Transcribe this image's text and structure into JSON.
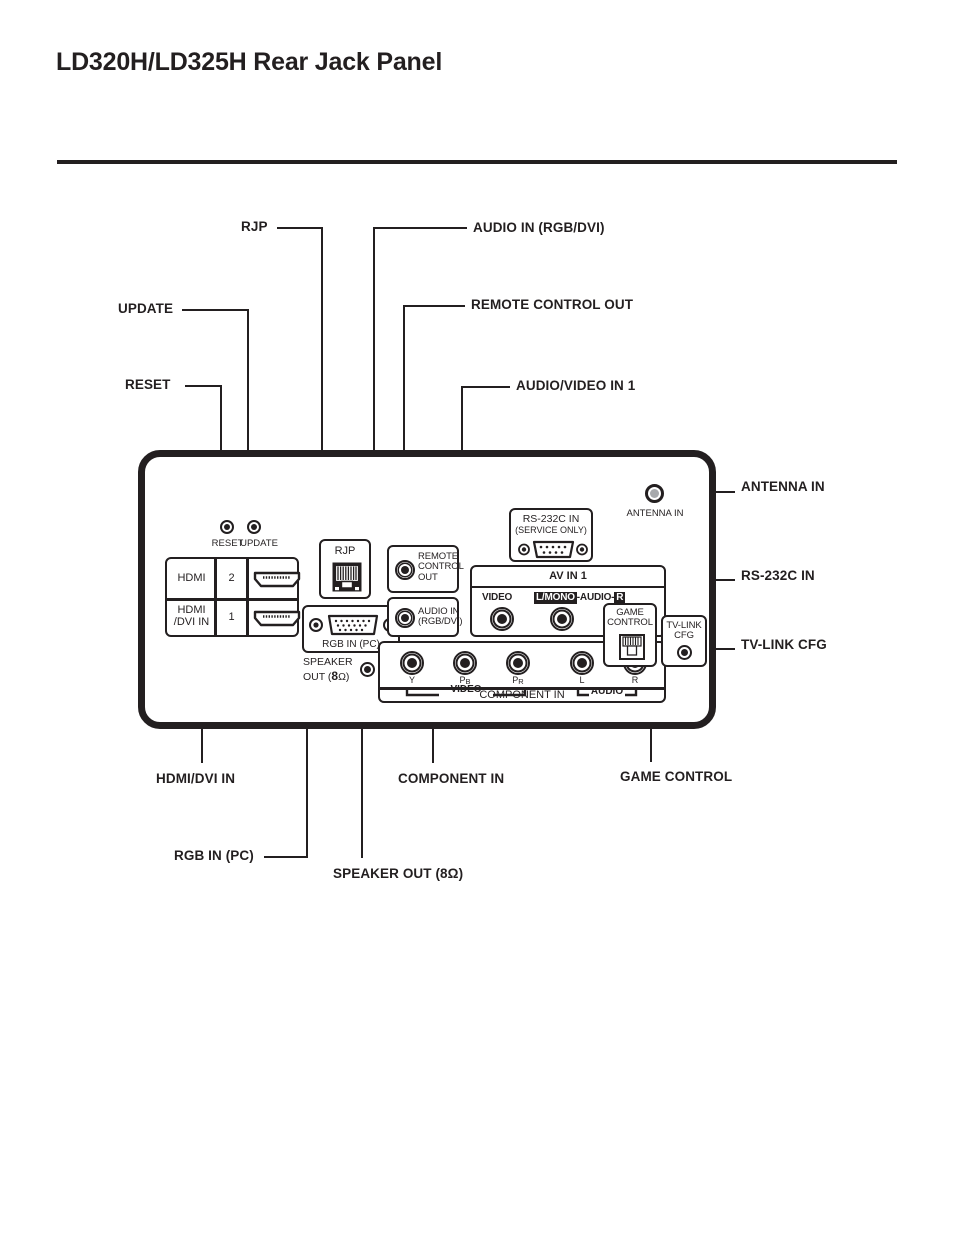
{
  "document": {
    "title": "LD320H/LD325H Rear Jack Panel"
  },
  "callouts": {
    "rjp": "RJP",
    "audio_in_rgb_dvi": "AUDIO IN (RGB/DVI)",
    "update": "UPDATE",
    "remote_control_out": "REMOTE CONTROL OUT",
    "reset": "RESET",
    "audio_video_in_1": "AUDIO/VIDEO IN 1",
    "antenna_in": "ANTENNA IN",
    "rs232c_in": "RS-232C IN",
    "tv_link_cfg": "TV-LINK CFG",
    "hdmi_dvi_in": "HDMI/DVI IN",
    "component_in": "COMPONENT IN",
    "game_control": "GAME CONTROL",
    "rgb_in_pc": "RGB IN (PC)",
    "speaker_out": "SPEAKER OUT (8Ω)"
  },
  "panel": {
    "reset_label": "RESET",
    "update_label": "UPDATE",
    "hdmi": {
      "row1_name": "HDMI",
      "row1_num": "2",
      "row2_name": "HDMI\n/DVI IN",
      "row2_num": "1"
    },
    "rjp_label": "RJP",
    "rgb_in_pc_label": "RGB IN (PC)",
    "speaker_out_line1": "SPEAKER",
    "speaker_out_line2_pre": "OUT (",
    "speaker_out_ohm": "8",
    "speaker_out_line2_post": "Ω)",
    "remote_control_out_label": "REMOTE\nCONTROL\nOUT",
    "audio_in_label": "AUDIO IN\n(RGB/DVI)",
    "rs232c_line1": "RS-232C IN",
    "rs232c_line2": "(SERVICE ONLY)",
    "av_in_1_title": "AV IN 1",
    "av_video": "VIDEO",
    "av_l_mono": "L/MONO",
    "av_audio": "-AUDIO-",
    "av_r": "R",
    "component": {
      "y": "Y",
      "pb_base": "P",
      "pb_sub": "B",
      "pr_base": "P",
      "pr_sub": "R",
      "l": "L",
      "r": "R",
      "video_group": "VIDEO",
      "audio_group": "AUDIO",
      "title": "COMPONENT IN"
    },
    "antenna_in_label": "ANTENNA IN",
    "game_control_label": "GAME\nCONTROL",
    "tv_link_label": "TV-LINK\nCFG"
  },
  "colors": {
    "ink": "#231f20",
    "paper": "#ffffff",
    "antenna_pin": "#a7a9ac"
  }
}
